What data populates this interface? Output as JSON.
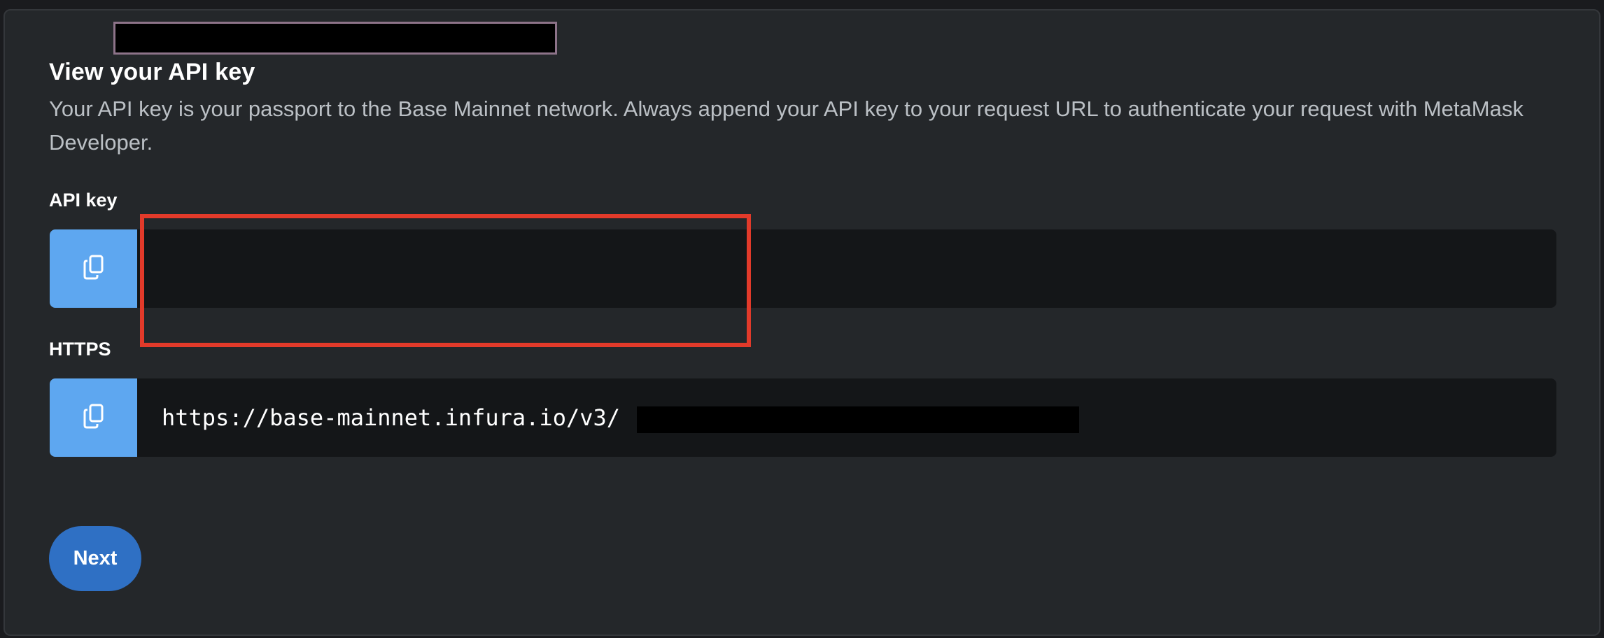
{
  "section": {
    "title": "View your API key",
    "description": "Your API key is your passport to the Base Mainnet network. Always append your API key to your request URL to authenticate your request with MetaMask Developer."
  },
  "api_key": {
    "label": "API key",
    "value": "",
    "copy_icon": "copy-icon",
    "redacted": true
  },
  "https": {
    "label": "HTTPS",
    "value": "https://base-mainnet.infura.io/v3/",
    "copy_icon": "copy-icon",
    "redacted": true
  },
  "actions": {
    "next_label": "Next"
  },
  "colors": {
    "copy_button": "#5ea7f0",
    "next_button": "#2f70c4",
    "highlight_box": "#e23a2a",
    "panel_background": "#24272a",
    "field_background": "#141618"
  }
}
